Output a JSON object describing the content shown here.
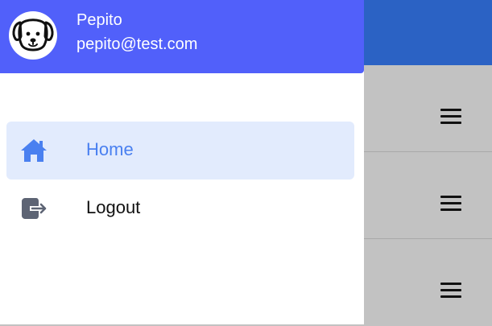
{
  "drawer": {
    "user": {
      "name": "Pepito",
      "email": "pepito@test.com"
    },
    "items": [
      {
        "label": "Home",
        "icon": "home-icon",
        "active": true
      },
      {
        "label": "Logout",
        "icon": "logout-icon",
        "active": false
      }
    ]
  },
  "background": {
    "row_count": 3,
    "row_icon": "menu-icon"
  },
  "colors": {
    "drawer_header": "#5160fa",
    "app_header": "#2b62c4",
    "active_item_bg": "#e2ebfd",
    "active_item_text": "#4a80f0",
    "scrim_bg": "#c2c2c2"
  }
}
